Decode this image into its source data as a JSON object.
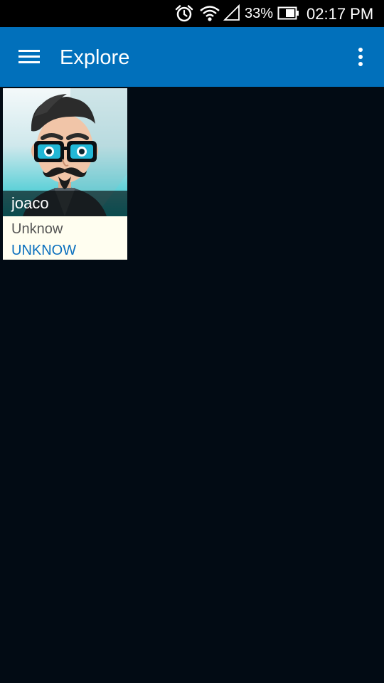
{
  "status_bar": {
    "battery_percent": "33%",
    "time": "02:17 PM",
    "icons": [
      "alarm-icon",
      "wifi-icon",
      "signal-icon",
      "battery-icon"
    ]
  },
  "app_bar": {
    "title": "Explore",
    "menu_icon": "hamburger-menu-icon",
    "overflow_icon": "overflow-menu-icon",
    "color": "#0170bb"
  },
  "cards": [
    {
      "name": "joaco",
      "status": "Unknow",
      "action": "UNKNOW",
      "avatar": "hipster-avatar"
    }
  ],
  "colors": {
    "background": "#020b14",
    "card": "#fffef0",
    "link": "#0a6fbe"
  }
}
